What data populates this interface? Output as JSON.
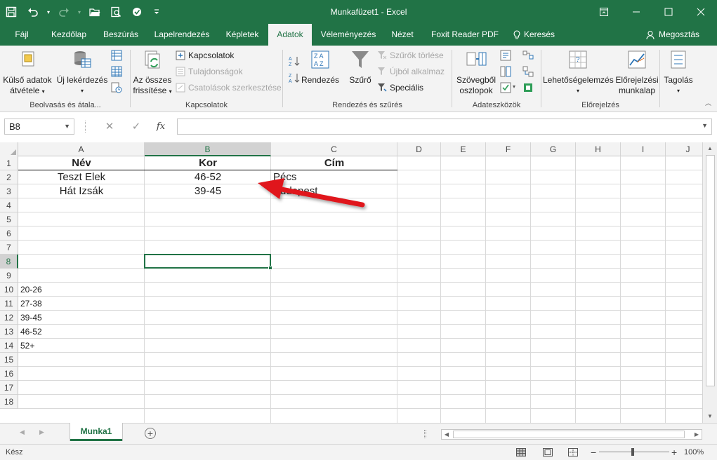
{
  "app": {
    "window_title": "Munkafüzet1  -  Excel",
    "accent_color": "#217346"
  },
  "quick_access": [
    "save-icon",
    "undo-icon",
    "redo-icon",
    "open-folder-icon",
    "print-preview-icon",
    "touch-mode-icon",
    "customize-qat-icon"
  ],
  "tabs": [
    {
      "label": "Fájl",
      "active": false
    },
    {
      "label": "Kezdőlap",
      "active": false
    },
    {
      "label": "Beszúrás",
      "active": false
    },
    {
      "label": "Lapelrendezés",
      "active": false
    },
    {
      "label": "Képletek",
      "active": false
    },
    {
      "label": "Adatok",
      "active": true
    },
    {
      "label": "Véleményezés",
      "active": false
    },
    {
      "label": "Nézet",
      "active": false
    },
    {
      "label": "Foxit Reader PDF",
      "active": false
    }
  ],
  "search_label": "Keresés",
  "share_label": "Megosztás",
  "ribbon": {
    "get_data": {
      "external_l1": "Külső adatok",
      "external_l2": "átvétele",
      "new_query": "Új lekérdezés",
      "group_label": "Beolvasás és átala..."
    },
    "connections": {
      "refresh_l1": "Az összes",
      "refresh_l2": "frissítése",
      "connections": "Kapcsolatok",
      "properties": "Tulajdonságok",
      "edit_links": "Csatolások szerkesztése",
      "group_label": "Kapcsolatok"
    },
    "sort_filter": {
      "sort": "Rendezés",
      "filter": "Szűrő",
      "clear": "Szűrők törlése",
      "reapply": "Újból alkalmaz",
      "advanced": "Speciális",
      "group_label": "Rendezés és szűrés"
    },
    "data_tools": {
      "text_to_cols_l1": "Szövegből",
      "text_to_cols_l2": "oszlopok",
      "group_label": "Adateszközök"
    },
    "forecast": {
      "whatif": "Lehetőségelemzés",
      "forecast_l1": "Előrejelzési",
      "forecast_l2": "munkalap",
      "group_label": "Előrejelzés"
    },
    "outline": {
      "outline": "Tagolás"
    }
  },
  "formula_bar": {
    "name_box": "B8",
    "cancel": "✕",
    "enter": "✓",
    "fx": "fx",
    "value": ""
  },
  "columns": [
    "A",
    "B",
    "C",
    "D",
    "E",
    "F",
    "G",
    "H",
    "I",
    "J"
  ],
  "rows": [
    "1",
    "2",
    "3",
    "4",
    "5",
    "6",
    "7",
    "8",
    "9",
    "10",
    "11",
    "12",
    "13",
    "14",
    "15",
    "16",
    "17",
    "18"
  ],
  "cells": {
    "A1": "Név",
    "B1": "Kor",
    "C1": "Cím",
    "A2": "Teszt Elek",
    "B2": "46-52",
    "C2": "Pécs",
    "A3": "Hát Izsák",
    "B3": "39-45",
    "C3": "Budapest",
    "A10": "20-26",
    "A11": "27-38",
    "A12": "39-45",
    "A13": "46-52",
    "A14": "52+"
  },
  "selected_cell": "B8",
  "sheet_tab": "Munka1",
  "status": {
    "ready": "Kész",
    "zoom": "100%",
    "minus": "−",
    "plus": "+"
  },
  "annotation_arrow_color": "#e0161b"
}
